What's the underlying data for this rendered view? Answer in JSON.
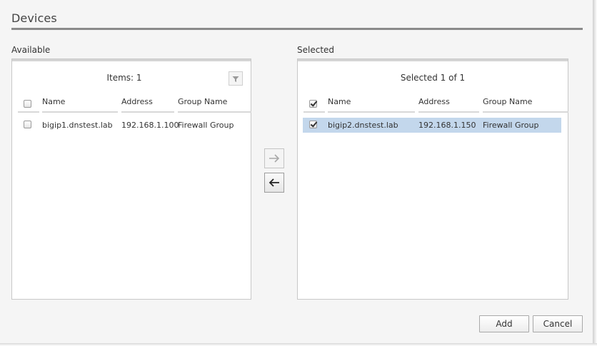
{
  "dialog": {
    "title": "Devices",
    "add_label": "Add",
    "cancel_label": "Cancel"
  },
  "available": {
    "label": "Available",
    "header": "Items: 1",
    "columns": [
      "Name",
      "Address",
      "Group Name"
    ],
    "rows": [
      {
        "name": "bigip1.dnstest.lab",
        "address": "192.168.1.100",
        "group": "Firewall Group",
        "checked": false
      }
    ]
  },
  "selected": {
    "label": "Selected",
    "header": "Selected 1 of 1",
    "columns": [
      "Name",
      "Address",
      "Group Name"
    ],
    "rows": [
      {
        "name": "bigip2.dnstest.lab",
        "address": "192.168.1.150",
        "group": "Firewall Group",
        "checked": true
      }
    ]
  },
  "icons": {
    "filter": "filter-icon",
    "move_right": "arrow-right-icon",
    "move_left": "arrow-left-icon"
  },
  "colors": {
    "selected_row": "#c3d7ec",
    "title_rule": "#8a8a8a"
  }
}
